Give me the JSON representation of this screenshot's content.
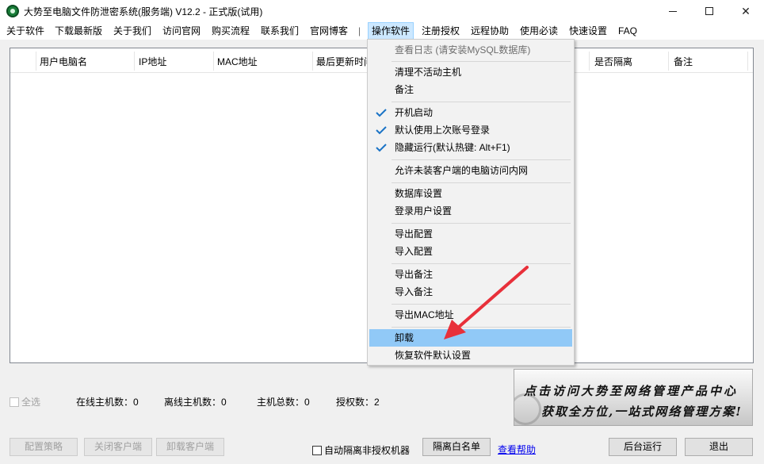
{
  "window": {
    "title": "大势至电脑文件防泄密系统(服务端) V12.2 - 正式版(试用)",
    "min_icon": "minimize-icon",
    "max_icon": "maximize-icon",
    "close_icon": "close-icon",
    "close_glyph": "✕"
  },
  "menu": {
    "about": "关于软件",
    "download": "下载最新版",
    "about_us": "关于我们",
    "website": "访问官网",
    "purchase": "购买流程",
    "contact": "联系我们",
    "blog": "官网博客",
    "separator": "|",
    "operate": "操作软件",
    "register": "注册授权",
    "remote": "远程协助",
    "must_read": "使用必读",
    "quick_setup": "快速设置",
    "faq": "FAQ"
  },
  "table": {
    "columns": [
      "用户电脑名",
      "IP地址",
      "MAC地址",
      "最后更新时间",
      "是否隔离",
      "备注"
    ]
  },
  "dropdown": {
    "items": [
      {
        "label": "查看日志 (请安装MySQL数据库)",
        "disabled": true
      },
      {
        "label": "清理不活动主机"
      },
      {
        "label": "备注"
      },
      {
        "label": "开机启动",
        "checked": true
      },
      {
        "label": "默认使用上次账号登录",
        "checked": true
      },
      {
        "label": "隐藏运行(默认热键: Alt+F1)",
        "checked": true
      },
      {
        "label": "允许未装客户端的电脑访问内网"
      },
      {
        "label": "数据库设置"
      },
      {
        "label": "登录用户设置"
      },
      {
        "label": "导出配置"
      },
      {
        "label": "导入配置"
      },
      {
        "label": "导出备注"
      },
      {
        "label": "导入备注"
      },
      {
        "label": "导出MAC地址"
      },
      {
        "label": "卸载",
        "highlighted": true
      },
      {
        "label": "恢复软件默认设置"
      }
    ]
  },
  "stats": {
    "select_all": "全选",
    "online": "在线主机数：0",
    "offline": "离线主机数：0",
    "total": "主机总数：0",
    "licenses": "授权数：2"
  },
  "buttons": {
    "config_policy": "配置策略",
    "close_client": "关闭客户端",
    "uninstall_client": "卸载客户端",
    "auto_isolate": "自动隔离非授权机器",
    "whitelist": "隔离白名单",
    "help": "查看帮助",
    "background_run": "后台运行",
    "exit": "退出"
  },
  "banner": {
    "line1": "点击访问大势至网络管理产品中心",
    "line2": "获取全方位,一站式网络管理方案!"
  },
  "colors": {
    "highlight": "#91c9f7",
    "check": "#1a73c6",
    "arrow": "#e8303a",
    "link": "#0000ee"
  }
}
